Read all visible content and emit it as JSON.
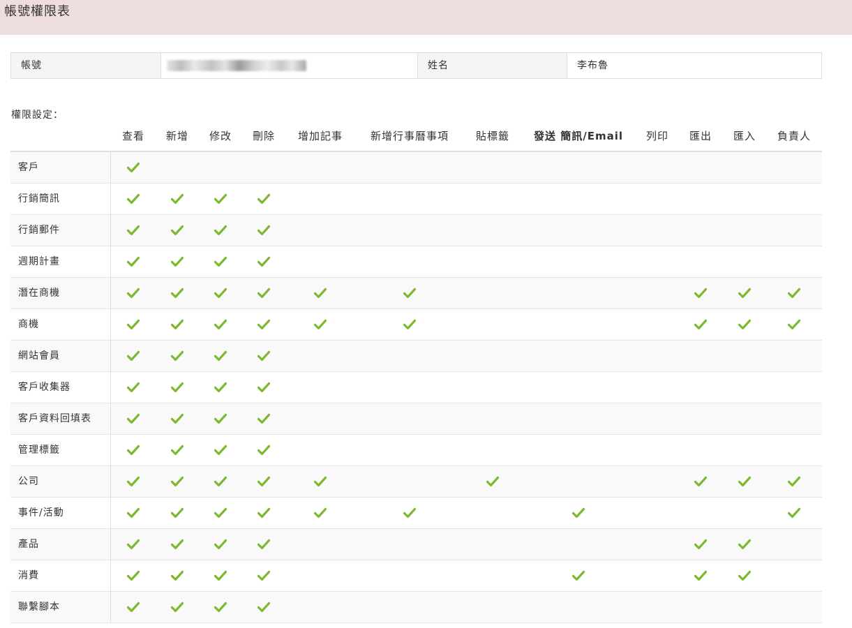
{
  "page": {
    "title": "帳號權限表"
  },
  "info": {
    "account_label": "帳號",
    "account_value": "",
    "name_label": "姓名",
    "name_value": "李布魯"
  },
  "permissions": {
    "section_label": "權限設定：",
    "columns": [
      "查看",
      "新增",
      "修改",
      "刪除",
      "增加記事",
      "新增行事曆事項",
      "貼標籤",
      "發送 簡訊/Email",
      "列印",
      "匯出",
      "匯入",
      "負責人"
    ],
    "rows": [
      {
        "name": "客戶",
        "checks": [
          1,
          0,
          0,
          0,
          0,
          0,
          0,
          0,
          0,
          0,
          0,
          0
        ]
      },
      {
        "name": "行銷簡訊",
        "checks": [
          1,
          1,
          1,
          1,
          0,
          0,
          0,
          0,
          0,
          0,
          0,
          0
        ]
      },
      {
        "name": "行銷郵件",
        "checks": [
          1,
          1,
          1,
          1,
          0,
          0,
          0,
          0,
          0,
          0,
          0,
          0
        ]
      },
      {
        "name": "週期計畫",
        "checks": [
          1,
          1,
          1,
          1,
          0,
          0,
          0,
          0,
          0,
          0,
          0,
          0
        ]
      },
      {
        "name": "潛在商機",
        "checks": [
          1,
          1,
          1,
          1,
          1,
          1,
          0,
          0,
          0,
          1,
          1,
          1
        ]
      },
      {
        "name": "商機",
        "checks": [
          1,
          1,
          1,
          1,
          1,
          1,
          0,
          0,
          0,
          1,
          1,
          1
        ]
      },
      {
        "name": "網站會員",
        "checks": [
          1,
          1,
          1,
          1,
          0,
          0,
          0,
          0,
          0,
          0,
          0,
          0
        ]
      },
      {
        "name": "客戶收集器",
        "checks": [
          1,
          1,
          1,
          1,
          0,
          0,
          0,
          0,
          0,
          0,
          0,
          0
        ]
      },
      {
        "name": "客戶資料回填表",
        "checks": [
          1,
          1,
          1,
          1,
          0,
          0,
          0,
          0,
          0,
          0,
          0,
          0
        ]
      },
      {
        "name": "管理標籤",
        "checks": [
          1,
          1,
          1,
          1,
          0,
          0,
          0,
          0,
          0,
          0,
          0,
          0
        ]
      },
      {
        "name": "公司",
        "checks": [
          1,
          1,
          1,
          1,
          1,
          0,
          1,
          0,
          0,
          1,
          1,
          1
        ]
      },
      {
        "name": "事件/活動",
        "checks": [
          1,
          1,
          1,
          1,
          1,
          1,
          0,
          1,
          0,
          0,
          0,
          1
        ]
      },
      {
        "name": "產品",
        "checks": [
          1,
          1,
          1,
          1,
          0,
          0,
          0,
          0,
          0,
          1,
          1,
          0
        ]
      },
      {
        "name": "消費",
        "checks": [
          1,
          1,
          1,
          1,
          0,
          0,
          0,
          1,
          0,
          1,
          1,
          0
        ]
      },
      {
        "name": "聯繫腳本",
        "checks": [
          1,
          1,
          1,
          1,
          0,
          0,
          0,
          0,
          0,
          0,
          0,
          0
        ]
      }
    ]
  },
  "colors": {
    "titlebar_bg": "#eeddde",
    "check": "#7cb830"
  },
  "icons": {
    "check": "check-icon"
  }
}
